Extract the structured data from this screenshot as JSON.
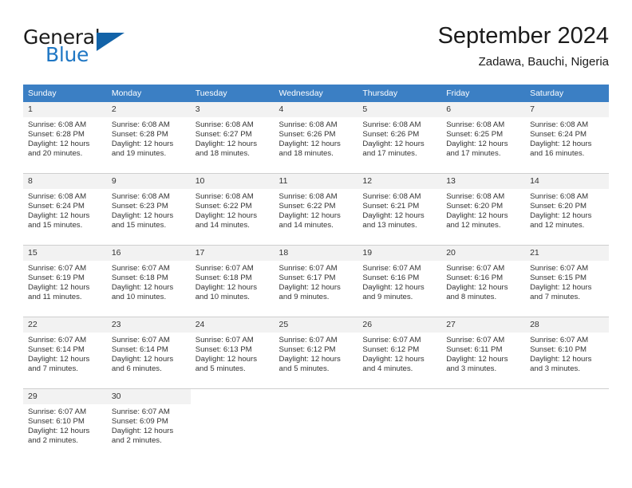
{
  "brand": {
    "name_top": "General",
    "name_bottom": "Blue",
    "color_dark": "#1b1b1b",
    "color_blue": "#1f77c4",
    "triangle_color": "#1263a8"
  },
  "header": {
    "title": "September 2024",
    "subtitle": "Zadawa, Bauchi, Nigeria"
  },
  "calendar": {
    "header_bg": "#3b7fc4",
    "daynum_bg": "#f2f2f2",
    "weekday_headers": [
      "Sunday",
      "Monday",
      "Tuesday",
      "Wednesday",
      "Thursday",
      "Friday",
      "Saturday"
    ],
    "weeks": [
      [
        {
          "day": "1",
          "sunrise": "Sunrise: 6:08 AM",
          "sunset": "Sunset: 6:28 PM",
          "daylight_1": "Daylight: 12 hours",
          "daylight_2": "and 20 minutes."
        },
        {
          "day": "2",
          "sunrise": "Sunrise: 6:08 AM",
          "sunset": "Sunset: 6:28 PM",
          "daylight_1": "Daylight: 12 hours",
          "daylight_2": "and 19 minutes."
        },
        {
          "day": "3",
          "sunrise": "Sunrise: 6:08 AM",
          "sunset": "Sunset: 6:27 PM",
          "daylight_1": "Daylight: 12 hours",
          "daylight_2": "and 18 minutes."
        },
        {
          "day": "4",
          "sunrise": "Sunrise: 6:08 AM",
          "sunset": "Sunset: 6:26 PM",
          "daylight_1": "Daylight: 12 hours",
          "daylight_2": "and 18 minutes."
        },
        {
          "day": "5",
          "sunrise": "Sunrise: 6:08 AM",
          "sunset": "Sunset: 6:26 PM",
          "daylight_1": "Daylight: 12 hours",
          "daylight_2": "and 17 minutes."
        },
        {
          "day": "6",
          "sunrise": "Sunrise: 6:08 AM",
          "sunset": "Sunset: 6:25 PM",
          "daylight_1": "Daylight: 12 hours",
          "daylight_2": "and 17 minutes."
        },
        {
          "day": "7",
          "sunrise": "Sunrise: 6:08 AM",
          "sunset": "Sunset: 6:24 PM",
          "daylight_1": "Daylight: 12 hours",
          "daylight_2": "and 16 minutes."
        }
      ],
      [
        {
          "day": "8",
          "sunrise": "Sunrise: 6:08 AM",
          "sunset": "Sunset: 6:24 PM",
          "daylight_1": "Daylight: 12 hours",
          "daylight_2": "and 15 minutes."
        },
        {
          "day": "9",
          "sunrise": "Sunrise: 6:08 AM",
          "sunset": "Sunset: 6:23 PM",
          "daylight_1": "Daylight: 12 hours",
          "daylight_2": "and 15 minutes."
        },
        {
          "day": "10",
          "sunrise": "Sunrise: 6:08 AM",
          "sunset": "Sunset: 6:22 PM",
          "daylight_1": "Daylight: 12 hours",
          "daylight_2": "and 14 minutes."
        },
        {
          "day": "11",
          "sunrise": "Sunrise: 6:08 AM",
          "sunset": "Sunset: 6:22 PM",
          "daylight_1": "Daylight: 12 hours",
          "daylight_2": "and 14 minutes."
        },
        {
          "day": "12",
          "sunrise": "Sunrise: 6:08 AM",
          "sunset": "Sunset: 6:21 PM",
          "daylight_1": "Daylight: 12 hours",
          "daylight_2": "and 13 minutes."
        },
        {
          "day": "13",
          "sunrise": "Sunrise: 6:08 AM",
          "sunset": "Sunset: 6:20 PM",
          "daylight_1": "Daylight: 12 hours",
          "daylight_2": "and 12 minutes."
        },
        {
          "day": "14",
          "sunrise": "Sunrise: 6:08 AM",
          "sunset": "Sunset: 6:20 PM",
          "daylight_1": "Daylight: 12 hours",
          "daylight_2": "and 12 minutes."
        }
      ],
      [
        {
          "day": "15",
          "sunrise": "Sunrise: 6:07 AM",
          "sunset": "Sunset: 6:19 PM",
          "daylight_1": "Daylight: 12 hours",
          "daylight_2": "and 11 minutes."
        },
        {
          "day": "16",
          "sunrise": "Sunrise: 6:07 AM",
          "sunset": "Sunset: 6:18 PM",
          "daylight_1": "Daylight: 12 hours",
          "daylight_2": "and 10 minutes."
        },
        {
          "day": "17",
          "sunrise": "Sunrise: 6:07 AM",
          "sunset": "Sunset: 6:18 PM",
          "daylight_1": "Daylight: 12 hours",
          "daylight_2": "and 10 minutes."
        },
        {
          "day": "18",
          "sunrise": "Sunrise: 6:07 AM",
          "sunset": "Sunset: 6:17 PM",
          "daylight_1": "Daylight: 12 hours",
          "daylight_2": "and 9 minutes."
        },
        {
          "day": "19",
          "sunrise": "Sunrise: 6:07 AM",
          "sunset": "Sunset: 6:16 PM",
          "daylight_1": "Daylight: 12 hours",
          "daylight_2": "and 9 minutes."
        },
        {
          "day": "20",
          "sunrise": "Sunrise: 6:07 AM",
          "sunset": "Sunset: 6:16 PM",
          "daylight_1": "Daylight: 12 hours",
          "daylight_2": "and 8 minutes."
        },
        {
          "day": "21",
          "sunrise": "Sunrise: 6:07 AM",
          "sunset": "Sunset: 6:15 PM",
          "daylight_1": "Daylight: 12 hours",
          "daylight_2": "and 7 minutes."
        }
      ],
      [
        {
          "day": "22",
          "sunrise": "Sunrise: 6:07 AM",
          "sunset": "Sunset: 6:14 PM",
          "daylight_1": "Daylight: 12 hours",
          "daylight_2": "and 7 minutes."
        },
        {
          "day": "23",
          "sunrise": "Sunrise: 6:07 AM",
          "sunset": "Sunset: 6:14 PM",
          "daylight_1": "Daylight: 12 hours",
          "daylight_2": "and 6 minutes."
        },
        {
          "day": "24",
          "sunrise": "Sunrise: 6:07 AM",
          "sunset": "Sunset: 6:13 PM",
          "daylight_1": "Daylight: 12 hours",
          "daylight_2": "and 5 minutes."
        },
        {
          "day": "25",
          "sunrise": "Sunrise: 6:07 AM",
          "sunset": "Sunset: 6:12 PM",
          "daylight_1": "Daylight: 12 hours",
          "daylight_2": "and 5 minutes."
        },
        {
          "day": "26",
          "sunrise": "Sunrise: 6:07 AM",
          "sunset": "Sunset: 6:12 PM",
          "daylight_1": "Daylight: 12 hours",
          "daylight_2": "and 4 minutes."
        },
        {
          "day": "27",
          "sunrise": "Sunrise: 6:07 AM",
          "sunset": "Sunset: 6:11 PM",
          "daylight_1": "Daylight: 12 hours",
          "daylight_2": "and 3 minutes."
        },
        {
          "day": "28",
          "sunrise": "Sunrise: 6:07 AM",
          "sunset": "Sunset: 6:10 PM",
          "daylight_1": "Daylight: 12 hours",
          "daylight_2": "and 3 minutes."
        }
      ],
      [
        {
          "day": "29",
          "sunrise": "Sunrise: 6:07 AM",
          "sunset": "Sunset: 6:10 PM",
          "daylight_1": "Daylight: 12 hours",
          "daylight_2": "and 2 minutes."
        },
        {
          "day": "30",
          "sunrise": "Sunrise: 6:07 AM",
          "sunset": "Sunset: 6:09 PM",
          "daylight_1": "Daylight: 12 hours",
          "daylight_2": "and 2 minutes."
        },
        {
          "day": "",
          "sunrise": "",
          "sunset": "",
          "daylight_1": "",
          "daylight_2": ""
        },
        {
          "day": "",
          "sunrise": "",
          "sunset": "",
          "daylight_1": "",
          "daylight_2": ""
        },
        {
          "day": "",
          "sunrise": "",
          "sunset": "",
          "daylight_1": "",
          "daylight_2": ""
        },
        {
          "day": "",
          "sunrise": "",
          "sunset": "",
          "daylight_1": "",
          "daylight_2": ""
        },
        {
          "day": "",
          "sunrise": "",
          "sunset": "",
          "daylight_1": "",
          "daylight_2": ""
        }
      ]
    ]
  }
}
